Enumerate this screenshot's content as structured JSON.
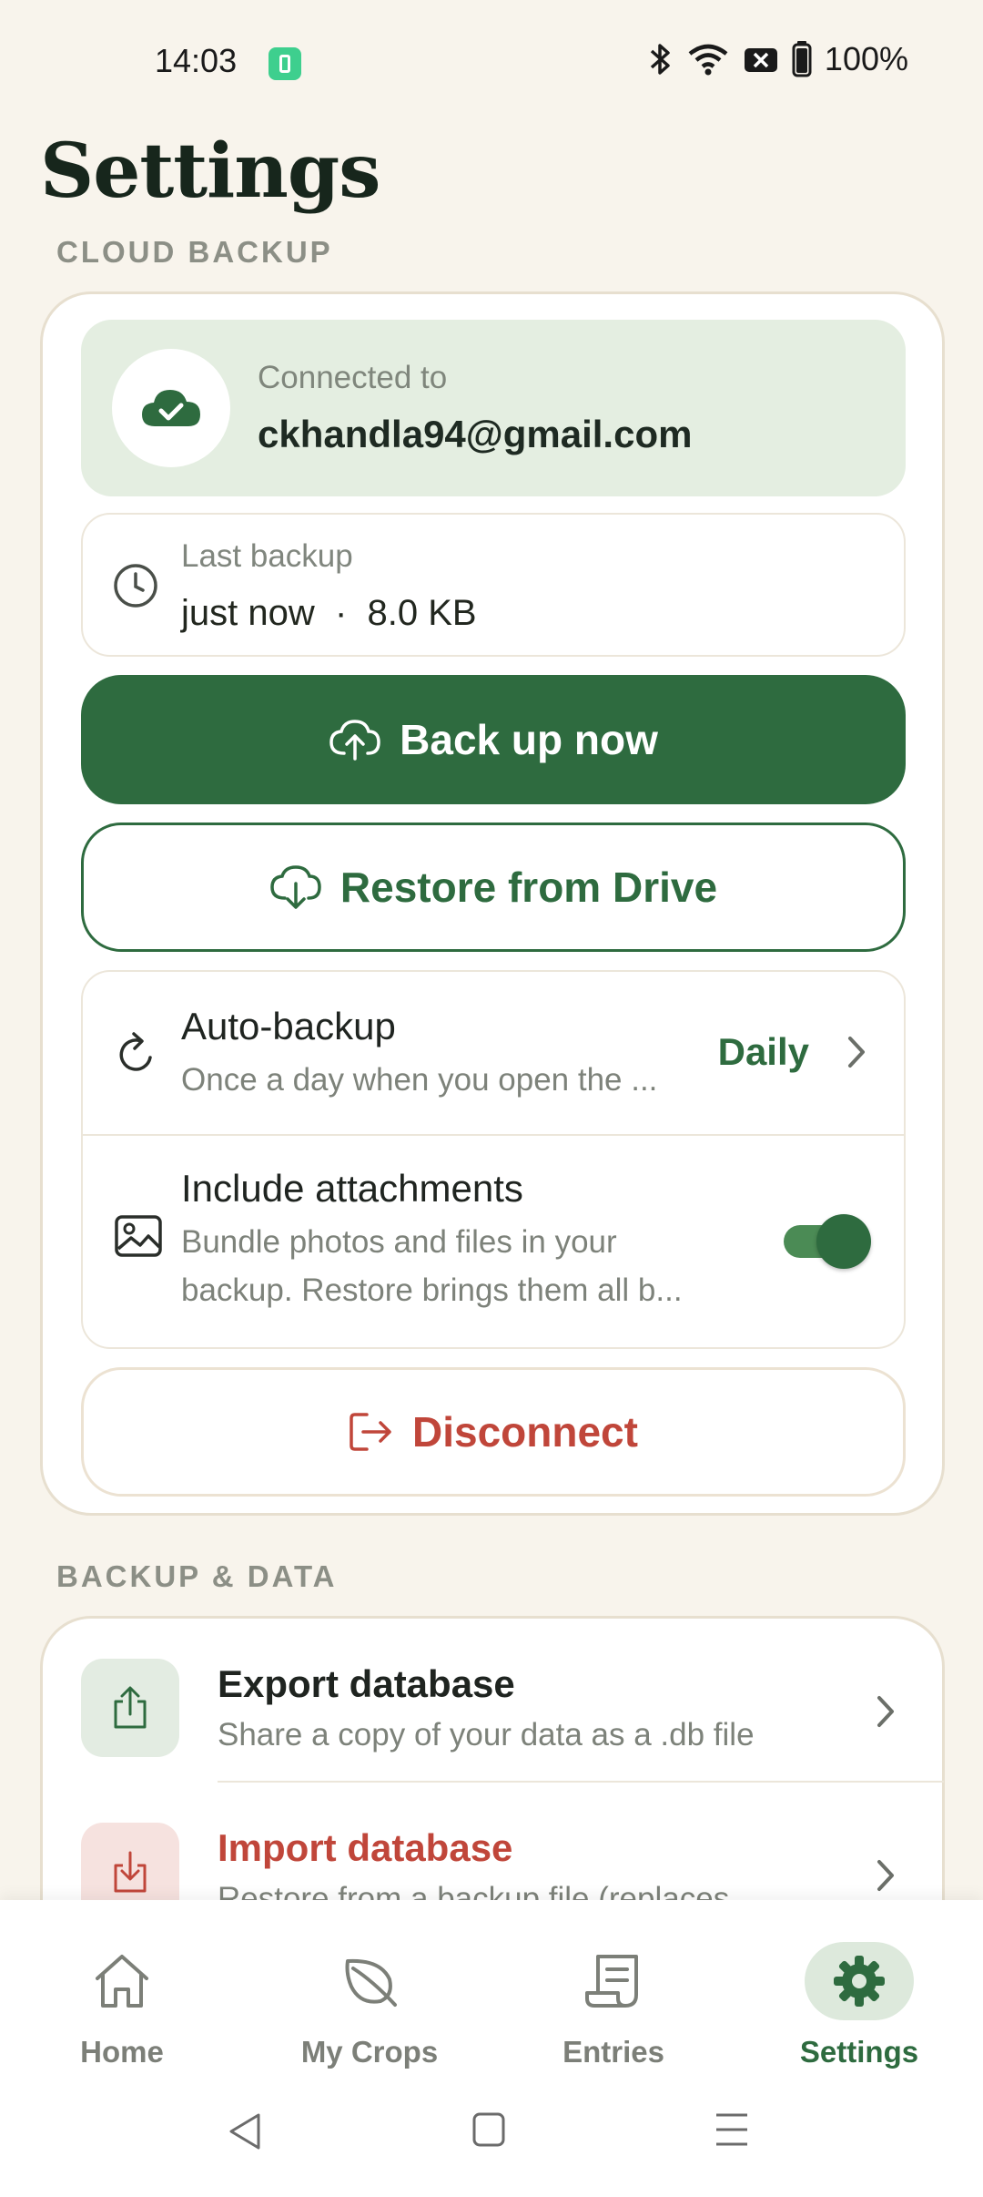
{
  "status_bar": {
    "time": "14:03",
    "battery": "100%"
  },
  "page": {
    "title": "Settings"
  },
  "cloud_backup": {
    "section_label": "CLOUD BACKUP",
    "connected_label": "Connected to",
    "account_email": "ckhandla94@gmail.com",
    "last_backup_label": "Last backup",
    "last_backup_value": "just now  ·  8.0 KB",
    "backup_now_label": "Back up now",
    "restore_label": "Restore from Drive",
    "auto_backup": {
      "title": "Auto-backup",
      "description": "Once a day when you open the ...",
      "value": "Daily"
    },
    "include_attachments": {
      "title": "Include attachments",
      "description": "Bundle photos and files in your backup. Restore brings them all b...",
      "enabled": true
    },
    "disconnect_label": "Disconnect"
  },
  "backup_data": {
    "section_label": "BACKUP & DATA",
    "items": [
      {
        "title": "Export database",
        "description": "Share a copy of your data as a .db file",
        "icon": "upload-icon"
      },
      {
        "title": "Import database",
        "description": "Restore from a backup file (replaces",
        "icon": "download-icon"
      }
    ]
  },
  "bottom_nav": {
    "items": [
      {
        "label": "Home",
        "icon": "home-icon"
      },
      {
        "label": "My Crops",
        "icon": "leaf-icon"
      },
      {
        "label": "Entries",
        "icon": "receipt-icon"
      },
      {
        "label": "Settings",
        "icon": "gear-icon",
        "active": true
      }
    ]
  },
  "colors": {
    "accent": "#2e6b3f",
    "danger": "#c0463a",
    "background": "#f8f4ec"
  }
}
